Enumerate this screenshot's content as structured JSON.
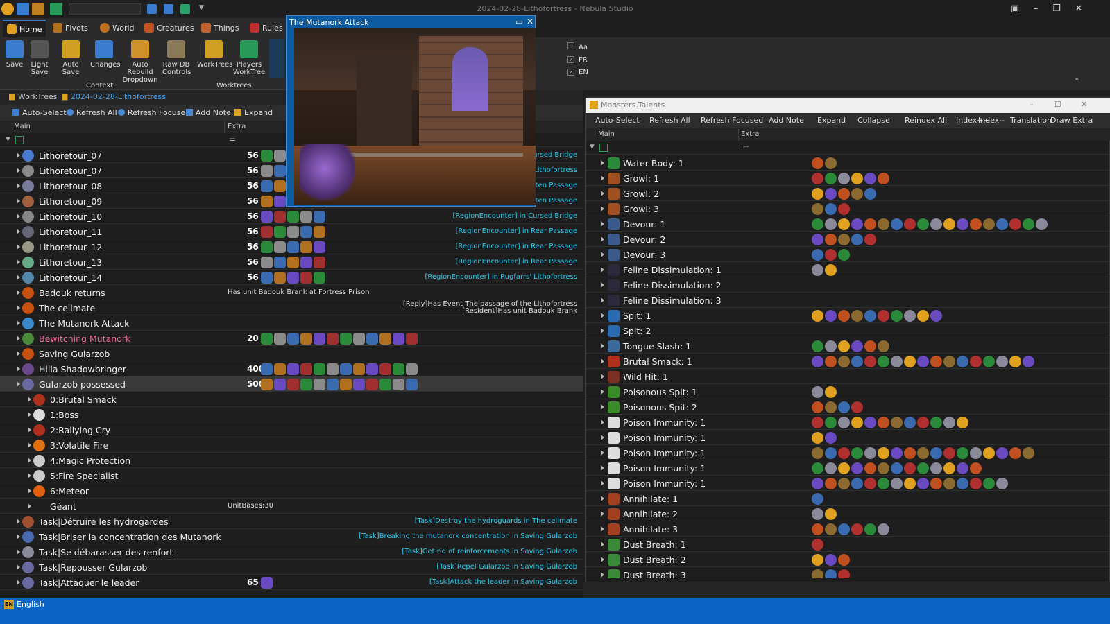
{
  "app": {
    "title": "2024-02-28-Lithofortress - Nebula Studio",
    "status_lang": "English",
    "status_icon": "EN"
  },
  "ribbon": {
    "tabs": [
      "Home",
      "Pivots",
      "World",
      "Creatures",
      "Things",
      "Rules"
    ],
    "buttons": [
      "Save",
      "Light Save",
      "Auto Save",
      "Changes",
      "Auto Rebuild Dropdown",
      "Raw DB Controls",
      "WorkTrees",
      "Players WorkTree"
    ],
    "groups": {
      "context": "Context",
      "worktrees": "Worktrees"
    },
    "checks": [
      {
        "label": "Aa",
        "checked": false
      },
      {
        "label": "FR",
        "checked": true
      },
      {
        "label": "EN",
        "checked": true
      }
    ]
  },
  "doc_tabs": [
    "WorkTrees",
    "2024-02-28-Lithofortress"
  ],
  "toolbar": [
    "Auto-Select",
    "Refresh All",
    "Refresh Focused",
    "Add Note",
    "Expand"
  ],
  "columns": {
    "main": "Main",
    "extra": "Extra"
  },
  "left_rows": [
    {
      "label": "Lithoretour_07",
      "val": "56",
      "right": "[RegionEncounter] in Cursed Bridge",
      "depth": 0,
      "color": "#4a7bd0"
    },
    {
      "label": "Lithoretour_07",
      "val": "56",
      "right": "[RegionEncounter] in Rugfarrs' Lithofortress",
      "depth": 0,
      "color": "#8a8a8a"
    },
    {
      "label": "Lithoretour_08",
      "val": "56",
      "right": "[RegionEncounter] in Forgotten Passage",
      "depth": 0,
      "color": "#7a7a9a"
    },
    {
      "label": "Lithoretour_09",
      "val": "56",
      "right": "[RegionEncounter] in Forgotten Passage",
      "depth": 0,
      "color": "#a06040"
    },
    {
      "label": "Lithoretour_10",
      "val": "56",
      "right": "[RegionEncounter] in Cursed Bridge",
      "depth": 0,
      "color": "#888"
    },
    {
      "label": "Lithoretour_11",
      "val": "56",
      "right": "[RegionEncounter] in Rear Passage",
      "depth": 0,
      "color": "#667"
    },
    {
      "label": "Lithoretour_12",
      "val": "56",
      "right": "[RegionEncounter] in Rear Passage",
      "depth": 0,
      "color": "#998"
    },
    {
      "label": "Lithoretour_13",
      "val": "56",
      "right": "[RegionEncounter] in Rear Passage",
      "depth": 0,
      "color": "#6a8"
    },
    {
      "label": "Lithoretour_14",
      "val": "56",
      "right": "[RegionEncounter] in Rugfarrs' Lithofortress",
      "depth": 0,
      "color": "#58a"
    },
    {
      "label": "Badouk returns",
      "val": "",
      "extra": "Has unit Badouk Brank at Fortress Prison",
      "right": "",
      "depth": 0,
      "color": "#c85010"
    },
    {
      "label": "The cellmate",
      "val": "",
      "right": "[Reply]Has Event The passage of the Lithofortress",
      "right2": "[Resident]Has unit Badouk Brank",
      "depth": 0,
      "color": "#c85010"
    },
    {
      "label": "The Mutanork Attack",
      "val": "",
      "right": "",
      "depth": 0,
      "color": "#3a8acf"
    },
    {
      "label": "Bewitching Mutanork",
      "val": "20",
      "pink": true,
      "right": "",
      "depth": 0,
      "color": "#4a8a3a"
    },
    {
      "label": "Saving Gularzob",
      "val": "",
      "right": "",
      "depth": 0,
      "color": "#c85010"
    },
    {
      "label": "Hilla Shadowbringer",
      "val": "400",
      "right": "",
      "depth": 0,
      "color": "#6a4a8a"
    },
    {
      "label": "Gularzob possessed",
      "val": "500",
      "right": "",
      "depth": 0,
      "color": "#6a6aa0",
      "sel": true
    },
    {
      "label": "0:Brutal Smack",
      "val": "",
      "right": "",
      "depth": 1,
      "color": "#b03020"
    },
    {
      "label": "1:Boss",
      "val": "",
      "right": "",
      "depth": 1,
      "color": "#ddd"
    },
    {
      "label": "2:Rallying Cry",
      "val": "",
      "right": "",
      "depth": 1,
      "color": "#b03020"
    },
    {
      "label": "3:Volatile Fire",
      "val": "",
      "right": "",
      "depth": 1,
      "color": "#e07010"
    },
    {
      "label": "4:Magic Protection",
      "val": "",
      "right": "",
      "depth": 1,
      "color": "#ccc"
    },
    {
      "label": "5:Fire Specialist",
      "val": "",
      "right": "",
      "depth": 1,
      "color": "#ccc"
    },
    {
      "label": "6:Meteor",
      "val": "",
      "right": "",
      "depth": 1,
      "color": "#e06010"
    },
    {
      "label": "Géant",
      "val": "",
      "extra": "UnitBases:30",
      "right": "",
      "depth": 1,
      "color": "transparent"
    },
    {
      "label": "Task|Détruire les hydrogardes",
      "val": "",
      "right": "[Task]Destroy the hydroguards in The cellmate",
      "depth": 0,
      "color": "#a05030"
    },
    {
      "label": "Task|Briser la concentration des Mutanork",
      "val": "",
      "right": "[Task]Breaking the mutanork concentration in Saving Gularzob",
      "depth": 0,
      "color": "#4a6ab0"
    },
    {
      "label": "Task|Se débarasser des renfort",
      "val": "",
      "right": "[Task]Get rid of reinforcements in Saving Gularzob",
      "depth": 0,
      "color": "#8a8a9a"
    },
    {
      "label": "Task|Repousser Gularzob",
      "val": "",
      "right": "[Task]Repel Gularzob in Saving Gularzob",
      "depth": 0,
      "color": "#6a6aa0"
    },
    {
      "label": "Task|Attaquer le leader",
      "val": "65",
      "right": "[Task]Attack the leader in Saving Gularzob",
      "depth": 0,
      "color": "#6a6aa0"
    }
  ],
  "popup": {
    "title": "The Mutanork Attack"
  },
  "monsters": {
    "title": "Monsters.Talents",
    "toolbar": [
      "Auto-Select",
      "Refresh All",
      "Refresh Focused",
      "Add Note",
      "Expand",
      "Collapse",
      "Reindex All",
      "Index++",
      "Index--",
      "Translation",
      "Draw Extra"
    ],
    "rows": [
      {
        "label": "Water Body: 1",
        "n": 2,
        "color": "#2a8a3a"
      },
      {
        "label": "Growl: 1",
        "n": 6,
        "color": "#a05020"
      },
      {
        "label": "Growl: 2",
        "n": 5,
        "color": "#a05020"
      },
      {
        "label": "Growl: 3",
        "n": 3,
        "color": "#a05020"
      },
      {
        "label": "Devour: 1",
        "n": 18,
        "color": "#3a5a8a"
      },
      {
        "label": "Devour: 2",
        "n": 5,
        "color": "#3a5a8a"
      },
      {
        "label": "Devour: 3",
        "n": 3,
        "color": "#3a5a8a"
      },
      {
        "label": "Feline Dissimulation: 1",
        "n": 2,
        "color": "#2a2a3a"
      },
      {
        "label": "Feline Dissimulation: 2",
        "n": 0,
        "color": "#2a2a3a"
      },
      {
        "label": "Feline Dissimulation: 3",
        "n": 0,
        "color": "#2a2a3a"
      },
      {
        "label": "Spit: 1",
        "n": 10,
        "color": "#2a6ab0"
      },
      {
        "label": "Spit: 2",
        "n": 0,
        "color": "#2a6ab0"
      },
      {
        "label": "Tongue Slash: 1",
        "n": 6,
        "color": "#3a6a9a"
      },
      {
        "label": "Brutal Smack: 1",
        "n": 17,
        "color": "#b03020"
      },
      {
        "label": "Wild Hit: 1",
        "n": 0,
        "color": "#7a3020"
      },
      {
        "label": "Poisonous Spit: 1",
        "n": 2,
        "color": "#3a8a2a"
      },
      {
        "label": "Poisonous Spit: 2",
        "n": 4,
        "color": "#3a8a2a"
      },
      {
        "label": "Poison Immunity: 1",
        "n": 12,
        "color": "#ddd"
      },
      {
        "label": "Poison Immunity: 1",
        "n": 2,
        "color": "#ddd"
      },
      {
        "label": "Poison Immunity: 1",
        "n": 17,
        "color": "#ddd"
      },
      {
        "label": "Poison Immunity: 1",
        "n": 13,
        "color": "#ddd"
      },
      {
        "label": "Poison Immunity: 1",
        "n": 15,
        "color": "#ddd"
      },
      {
        "label": "Annihilate: 1",
        "n": 1,
        "color": "#a04020"
      },
      {
        "label": "Annihilate: 2",
        "n": 2,
        "color": "#a04020"
      },
      {
        "label": "Annihilate: 3",
        "n": 6,
        "color": "#a04020"
      },
      {
        "label": "Dust Breath: 1",
        "n": 1,
        "color": "#3a8a3a"
      },
      {
        "label": "Dust Breath: 2",
        "n": 3,
        "color": "#3a8a3a"
      },
      {
        "label": "Dust Breath: 3",
        "n": 3,
        "color": "#3a8a3a"
      }
    ]
  }
}
